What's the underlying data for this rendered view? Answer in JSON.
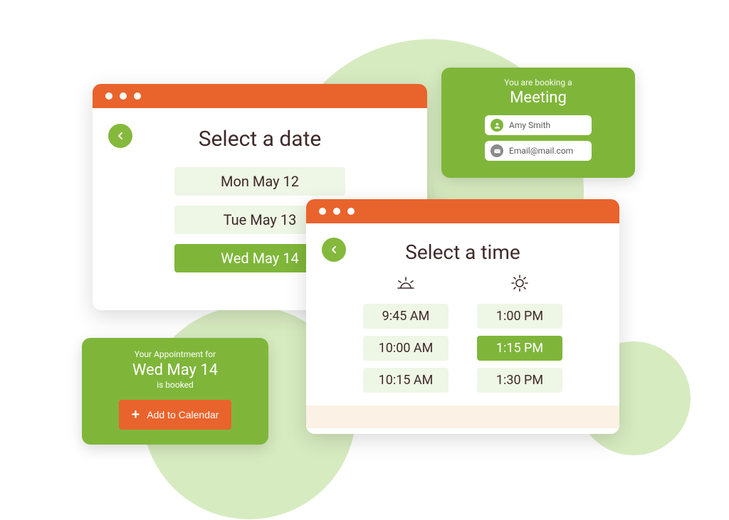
{
  "datePanel": {
    "heading": "Select a date",
    "dates": [
      {
        "label": "Mon May 12",
        "selected": false
      },
      {
        "label": "Tue May 13",
        "selected": false
      },
      {
        "label": "Wed May 14",
        "selected": true
      }
    ]
  },
  "timePanel": {
    "heading": "Select a time",
    "morning": [
      {
        "label": "9:45 AM",
        "selected": false
      },
      {
        "label": "10:00 AM",
        "selected": false
      },
      {
        "label": "10:15 AM",
        "selected": false
      }
    ],
    "afternoon": [
      {
        "label": "1:00 PM",
        "selected": false
      },
      {
        "label": "1:15 PM",
        "selected": true
      },
      {
        "label": "1:30 PM",
        "selected": false
      }
    ]
  },
  "bookingCard": {
    "sub": "You are booking a",
    "title": "Meeting",
    "name": "Amy Smith",
    "email": "Email@mail.com"
  },
  "confirmCard": {
    "sub": "Your Appointment for",
    "title": "Wed May 14",
    "sub2": "is booked",
    "button": "Add to Calendar"
  }
}
